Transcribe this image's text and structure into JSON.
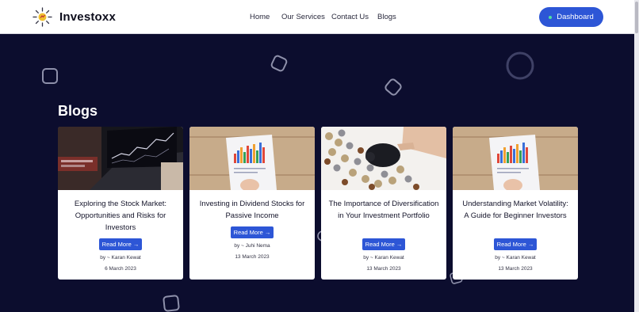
{
  "header": {
    "brand_name": "Investoxx",
    "nav": [
      {
        "label": "Home"
      },
      {
        "label": "Our Services"
      },
      {
        "label": "Contact Us"
      },
      {
        "label": "Blogs"
      }
    ],
    "dashboard_label": "Dashboard"
  },
  "section": {
    "title": "Blogs"
  },
  "posts": [
    {
      "title": "Exploring the Stock Market: Opportunities and Risks for Investors",
      "read_more": "Read More →",
      "author": "by ~ Karan Kewat",
      "date": "6 March 2023",
      "image": "laptop-stock-chart"
    },
    {
      "title": "Investing in Dividend Stocks for Passive Income",
      "read_more": "Read More →",
      "author": "by ~ Juhi Nema",
      "date": "13 March 2023",
      "image": "paper-bar-chart"
    },
    {
      "title": "The Importance of Diversification in Your Investment Portfolio",
      "read_more": "Read More →",
      "author": "by ~ Karan Kewat",
      "date": "13 March 2023",
      "image": "piggy-bank-coins"
    },
    {
      "title": "Understanding Market Volatility: A Guide for Beginner Investors",
      "read_more": "Read More →",
      "author": "by ~ Karan Kewat",
      "date": "13 March 2023",
      "image": "paper-bar-chart"
    }
  ],
  "colors": {
    "background": "#0c0d2e",
    "accent": "#2d56d6",
    "card": "#ffffff"
  }
}
